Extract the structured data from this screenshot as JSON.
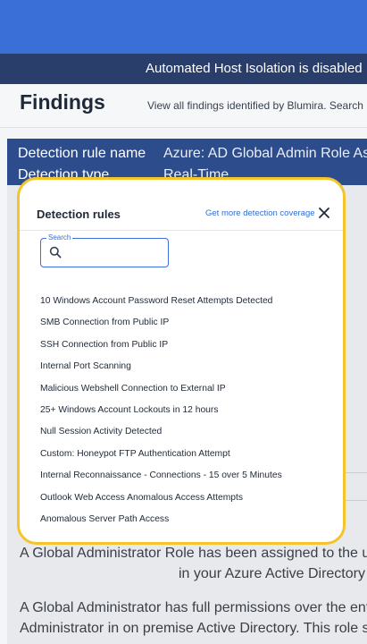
{
  "banner": {
    "text": "Automated Host Isolation is disabled"
  },
  "page": {
    "title": "Findings",
    "subtitle": "View all findings identified by Blumira. Search"
  },
  "detail": {
    "rule_name_label": "Detection rule name",
    "rule_name_value": "Azure: AD Global Admin Role Assigned",
    "type_label": "Detection type",
    "type_value": "Real-Time"
  },
  "description": {
    "line1": "A Global Administrator Role has been assigned to the user",
    "line2": "in your Azure Active Directory",
    "line3": "A Global Administrator has full permissions over the entire",
    "line4": "Administrator in on premise Active Directory. This role sh"
  },
  "modal": {
    "title": "Detection rules",
    "link": "Get more detection coverage",
    "search_label": "Search",
    "search_value": "",
    "rules": [
      "10 Windows Account Password Reset Attempts Detected",
      "SMB Connection from Public IP",
      "SSH Connection from Public IP",
      "Internal Port Scanning",
      "Malicious Webshell Connection to External IP",
      "25+ Windows Account Lockouts in 12 hours",
      "Null Session Activity Detected",
      "Custom: Honeypot FTP Authentication Attempt",
      "Internal Reconnaissance - Connections - 15 over 5 Minutes",
      "Outlook Web Access Anomalous Access Attempts",
      "Anomalous Server Path Access"
    ]
  },
  "colors": {
    "topbar": "#3b6fd8",
    "banner": "#2a3e6b",
    "detail_bar": "#2d4c8c",
    "modal_border": "#f3c52b",
    "link": "#2f6ed8"
  }
}
